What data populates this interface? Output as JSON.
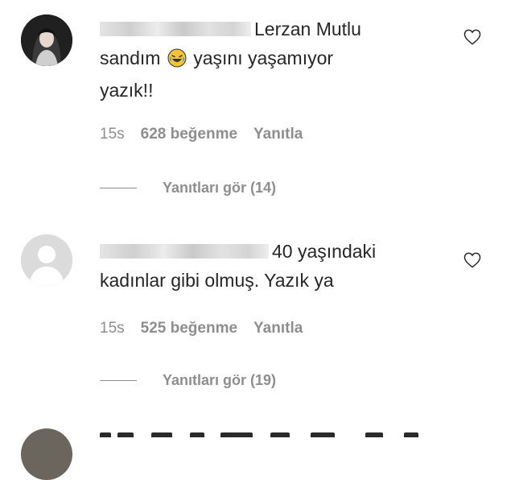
{
  "comments": [
    {
      "username_visible_suffix": "Lerzan Mutlu",
      "text_line1_after_emoji": "yaşını yaşamıyor",
      "text_prefix": "sandım",
      "text_line3": "yazık!!",
      "emoji": "laughing-tears-emoji",
      "time": "15s",
      "likes": "628 beğenme",
      "reply": "Yanıtla",
      "view_replies": "Yanıtları gör (14)",
      "avatar": "photo"
    },
    {
      "text_line1": "40 yaşındaki",
      "text_line2": "kadınlar gibi olmuş. Yazık ya",
      "time": "15s",
      "likes": "525 beğenme",
      "reply": "Yanıtla",
      "view_replies": "Yanıtları gör (19)",
      "avatar": "default"
    }
  ],
  "colors": {
    "text": "#262626",
    "meta": "#8e8e8e",
    "avatar_default": "#dbdbdb"
  }
}
